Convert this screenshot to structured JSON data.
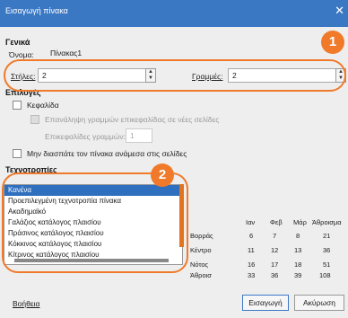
{
  "window": {
    "title": "Εισαγωγή πίνακα",
    "close_glyph": "✕"
  },
  "general": {
    "heading": "Γενικά",
    "name_label": "Όνομα:",
    "name_value": "Πίνακας1",
    "columns_label": "Στήλες:",
    "columns_value": "2",
    "rows_label": "Γραμμές:",
    "rows_value": "2"
  },
  "options": {
    "heading": "Επιλογές",
    "heading_checkbox": "Κεφαλίδα",
    "repeat_heading": "Επανάληψη γραμμών επικεφαλίδας σε νέες σελίδες",
    "heading_rows_label": "Επικεφαλίδες γραμμών:",
    "heading_rows_value": "1",
    "dont_split": "Μην διασπάτε τον πίνακα ανάμεσα στις σελίδες"
  },
  "styles": {
    "heading": "Τεχνοτροπίες",
    "items": [
      "Κανένα",
      "Προεπιλεγμένη τεχνοτροπία πίνακα",
      "Ακαδημαϊκό",
      "Γαλάζιος κατάλογος πλαισίου",
      "Πράσινος κατάλογος πλαισίου",
      "Κόκκινος κατάλογος πλαισίου",
      "Κίτρινος κατάλογος πλαισίου"
    ],
    "selected_index": 0
  },
  "preview": {
    "headers": [
      "Ιαν",
      "Φεβ",
      "Μάρ",
      "Άθροισμα"
    ],
    "rows": [
      {
        "label": "Βορράς",
        "values": [
          "6",
          "7",
          "8",
          "21"
        ]
      },
      {
        "label": "Κέντρο",
        "values": [
          "11",
          "12",
          "13",
          "36"
        ]
      },
      {
        "label": "Νότος",
        "values": [
          "16",
          "17",
          "18",
          "51"
        ]
      },
      {
        "label": "Άθροισ",
        "values": [
          "33",
          "36",
          "39",
          "108"
        ]
      }
    ]
  },
  "buttons": {
    "help": "Βοήθεια",
    "insert": "Εισαγωγή",
    "cancel": "Ακύρωση"
  },
  "callouts": {
    "first": "1",
    "second": "2"
  },
  "colors": {
    "titlebar": "#3b78c4",
    "accent": "#f07a2a",
    "selection": "#2f6fbf"
  }
}
